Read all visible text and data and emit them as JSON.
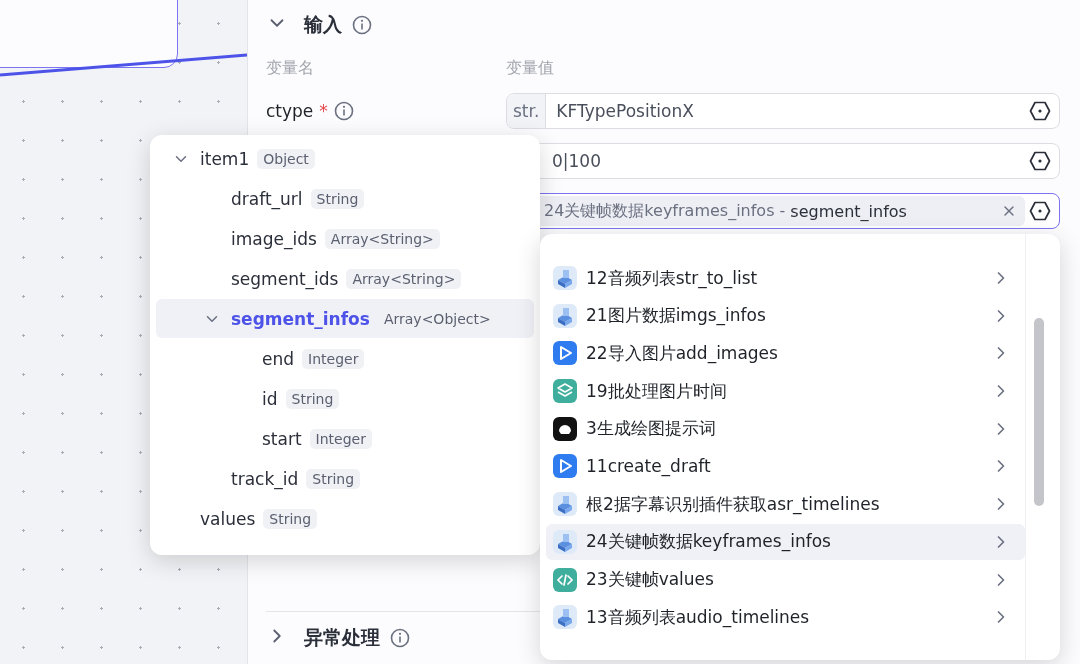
{
  "input_section": {
    "title": "输入",
    "expanded": true,
    "columns": [
      "变量名",
      "变量值"
    ],
    "params": [
      {
        "name": "ctype",
        "required_mark": "*",
        "prefix": "str.",
        "value": "KFTypePositionX",
        "kind": "text"
      },
      {
        "value": "0|100",
        "kind": "text"
      },
      {
        "kind": "reference",
        "source": "24关键帧数据keyframes_infos",
        "separator": " - ",
        "field": "segment_infos",
        "focused": true
      }
    ]
  },
  "error_section": {
    "title": "异常处理",
    "expanded": false
  },
  "field_tree": [
    {
      "name": "item1",
      "type": "Object",
      "expanded": true,
      "selected": false,
      "children": [
        {
          "name": "draft_url",
          "type": "String",
          "selected": false
        },
        {
          "name": "image_ids",
          "type": "Array<String>",
          "selected": false
        },
        {
          "name": "segment_ids",
          "type": "Array<String>",
          "selected": false
        },
        {
          "name": "segment_infos",
          "type": "Array<Object>",
          "expanded": true,
          "selected": true,
          "children": [
            {
              "name": "end",
              "type": "Integer",
              "selected": false
            },
            {
              "name": "id",
              "type": "String",
              "selected": false
            },
            {
              "name": "start",
              "type": "Integer",
              "selected": false
            }
          ]
        },
        {
          "name": "track_id",
          "type": "String",
          "selected": false
        }
      ]
    },
    {
      "name": "values",
      "type": "String",
      "selected": false
    }
  ],
  "node_menu": [
    {
      "label": "12音频列表str_to_list",
      "kind": "plugin",
      "selected": false
    },
    {
      "label": "21图片数据imgs_infos",
      "kind": "plugin",
      "selected": false
    },
    {
      "label": "22导入图片add_images",
      "kind": "video",
      "selected": false
    },
    {
      "label": "19批处理图片时间",
      "kind": "batch",
      "selected": false
    },
    {
      "label": "3生成绘图提示词",
      "kind": "llm",
      "selected": false
    },
    {
      "label": "11create_draft",
      "kind": "video",
      "selected": false
    },
    {
      "label": "根2据字幕识别插件获取asr_timelines",
      "kind": "plugin",
      "selected": false
    },
    {
      "label": "24关键帧数据keyframes_infos",
      "kind": "plugin",
      "selected": true
    },
    {
      "label": "23关键帧values",
      "kind": "code",
      "selected": false
    },
    {
      "label": "13音频列表audio_timelines",
      "kind": "plugin",
      "selected": false
    }
  ]
}
